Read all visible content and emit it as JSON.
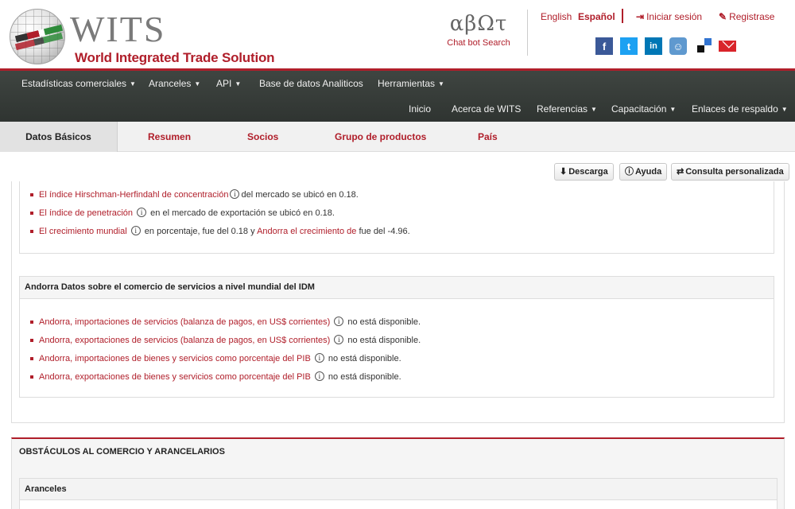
{
  "header": {
    "logo_wits": "WITS",
    "logo_subtitle": "World Integrated Trade Solution",
    "chatbot_logo": "αβΩτ",
    "chatbot_label": "Chat bot Search",
    "lang_english": "English",
    "lang_spanish": "Español",
    "login": "Iniciar sesión",
    "register": "Registrase",
    "social": [
      "facebook-icon",
      "twitter-icon",
      "linkedin-icon",
      "reddit-icon",
      "delicious-icon",
      "email-icon"
    ],
    "brand_color": "#b01e2a"
  },
  "nav": {
    "row1": [
      "Estadísticas comerciales",
      "Aranceles",
      "API",
      "Base de datos Analiticos",
      "Herramientas"
    ],
    "row2": [
      "Inicio",
      "Acerca de WITS",
      "Referencias",
      "Capacitación",
      "Enlaces de respaldo"
    ]
  },
  "tabs": [
    "Datos Básicos",
    "Resumen",
    "Socios",
    "Grupo de productos",
    "País"
  ],
  "toolbar": {
    "download": "Descarga",
    "help": "Ayuda",
    "custom_query": "Consulta personalizada"
  },
  "market_indicators": [
    {
      "link": "El índice Hirschman-Herfindahl de concentración",
      "text": "del mercado se ubicó en 0.18."
    },
    {
      "link": "El índice de penetración",
      "text": "en el mercado de exportación se ubicó en 0.18."
    },
    {
      "link": "El crecimiento mundial",
      "text_a": "en porcentaje, fue del 0.18 y",
      "link2": "Andorra el crecimiento de",
      "text_b": "fue del -4.96."
    }
  ],
  "services_section": {
    "title": "Andorra Datos sobre el comercio de servicios a nivel mundial del IDM",
    "items": [
      {
        "link": "Andorra, importaciones de servicios (balanza de pagos, en US$ corrientes)",
        "text": "no está disponible."
      },
      {
        "link": "Andorra, exportaciones de servicios (balanza de pagos, en US$ corrientes)",
        "text": "no está disponible."
      },
      {
        "link": "Andorra, importaciones de bienes y servicios como porcentaje del PIB",
        "text": "no está disponible."
      },
      {
        "link": "Andorra, exportaciones de bienes y servicios como porcentaje del PIB",
        "text": "no está disponible."
      }
    ]
  },
  "barriers_section": {
    "title": "OBSTÁCULOS AL COMERCIO Y ARANCELARIOS",
    "subsection": "Aranceles"
  }
}
